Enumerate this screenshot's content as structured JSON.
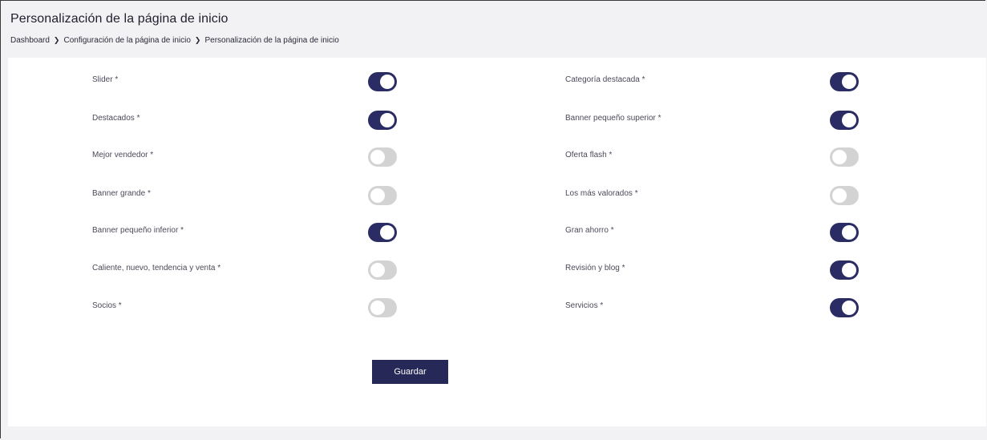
{
  "header": {
    "title": "Personalización de la página de inicio",
    "breadcrumb": [
      "Dashboard",
      "Configuración de la página de inicio",
      "Personalización de la página de inicio"
    ]
  },
  "left_settings": [
    {
      "label": "Slider *",
      "enabled": true
    },
    {
      "label": "Destacados *",
      "enabled": true
    },
    {
      "label": "Mejor vendedor *",
      "enabled": false
    },
    {
      "label": "Banner grande *",
      "enabled": false
    },
    {
      "label": "Banner pequeño inferior *",
      "enabled": true
    },
    {
      "label": "Caliente, nuevo, tendencia y venta *",
      "enabled": false
    },
    {
      "label": "Socios *",
      "enabled": false
    }
  ],
  "right_settings": [
    {
      "label": "Categoría destacada *",
      "enabled": true
    },
    {
      "label": "Banner pequeño superior *",
      "enabled": true
    },
    {
      "label": "Oferta flash *",
      "enabled": false
    },
    {
      "label": "Los más valorados *",
      "enabled": false
    },
    {
      "label": "Gran ahorro *",
      "enabled": true
    },
    {
      "label": "Revisión y blog *",
      "enabled": true
    },
    {
      "label": "Servicios *",
      "enabled": true
    }
  ],
  "actions": {
    "save_label": "Guardar"
  },
  "colors": {
    "toggle_on": "#2a2c63",
    "toggle_off": "#d3d3d3",
    "save_button": "#262957"
  }
}
